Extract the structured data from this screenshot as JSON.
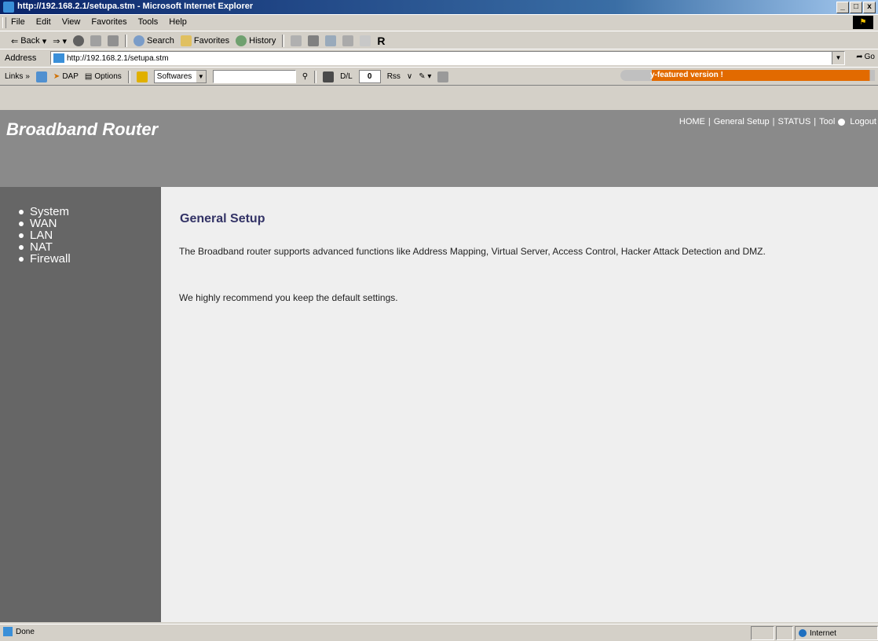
{
  "window": {
    "title": "http://192.168.2.1/setupa.stm - Microsoft Internet Explorer",
    "controls": [
      "_",
      "□",
      "x"
    ]
  },
  "menubar": {
    "items": [
      "File",
      "Edit",
      "View",
      "Favorites",
      "Tools",
      "Help"
    ]
  },
  "toolbar": {
    "back": "Back",
    "search": "Search",
    "favorites": "Favorites",
    "history": "History"
  },
  "address": {
    "label": "Address",
    "url": "http://192.168.2.1/setupa.stm",
    "go": "Go"
  },
  "links": {
    "label": "Links",
    "dap": "DAP",
    "options": "Options",
    "softwares": "Softwares",
    "dl_label": "D/L",
    "dl_value": "0",
    "promo": "y-featured version !"
  },
  "page": {
    "brand": "Broadband Router",
    "topnav": [
      "HOME",
      "General Setup",
      "STATUS",
      "Tool",
      "Logout"
    ],
    "sidebar": [
      "System",
      "WAN",
      "LAN",
      "NAT",
      "Firewall"
    ],
    "heading": "General Setup",
    "paragraph1": "The Broadband router supports advanced functions like Address Mapping, Virtual Server, Access Control, Hacker Attack Detection and DMZ.",
    "paragraph2": "We highly recommend you keep the default settings."
  },
  "statusbar": {
    "status": "Done",
    "zone": "Internet"
  },
  "colors": {
    "header_bg": "#8a8a8a",
    "sidebar_bg": "#666666",
    "content_bg": "#efefef",
    "heading": "#333366",
    "promo": "#e26a00"
  }
}
